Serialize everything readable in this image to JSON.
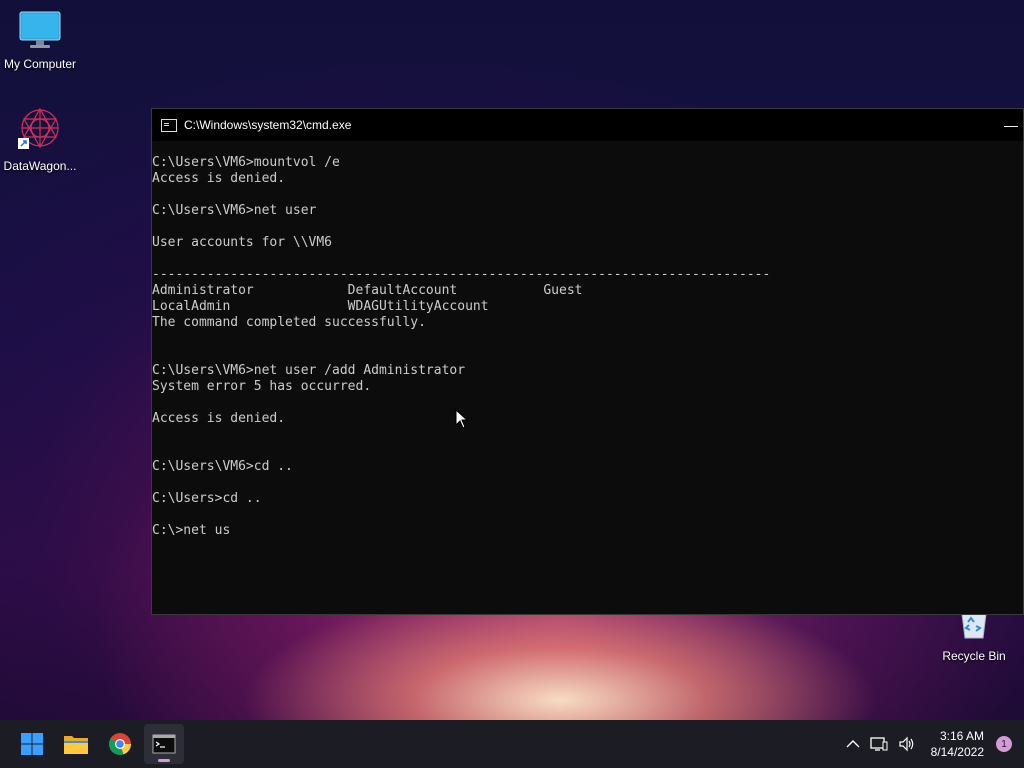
{
  "desktop": {
    "icons": [
      {
        "label": "My Computer"
      },
      {
        "label": "DataWagon..."
      },
      {
        "label": "Recycle Bin"
      }
    ]
  },
  "cmd": {
    "title": "C:\\Windows\\system32\\cmd.exe",
    "lines": [
      "C:\\Users\\VM6>mountvol /e",
      "Access is denied.",
      "",
      "C:\\Users\\VM6>net user",
      "",
      "User accounts for \\\\VM6",
      "",
      "-------------------------------------------------------------------------------",
      "Administrator            DefaultAccount           Guest",
      "LocalAdmin               WDAGUtilityAccount",
      "The command completed successfully.",
      "",
      "",
      "C:\\Users\\VM6>net user /add Administrator",
      "System error 5 has occurred.",
      "",
      "Access is denied.",
      "",
      "",
      "C:\\Users\\VM6>cd ..",
      "",
      "C:\\Users>cd ..",
      "",
      "C:\\>net us"
    ]
  },
  "taskbar": {
    "apps": [
      "start-button",
      "file-explorer",
      "chrome",
      "command-prompt"
    ],
    "clock_time": "3:16 AM",
    "clock_date": "8/14/2022",
    "notification_count": "1"
  }
}
